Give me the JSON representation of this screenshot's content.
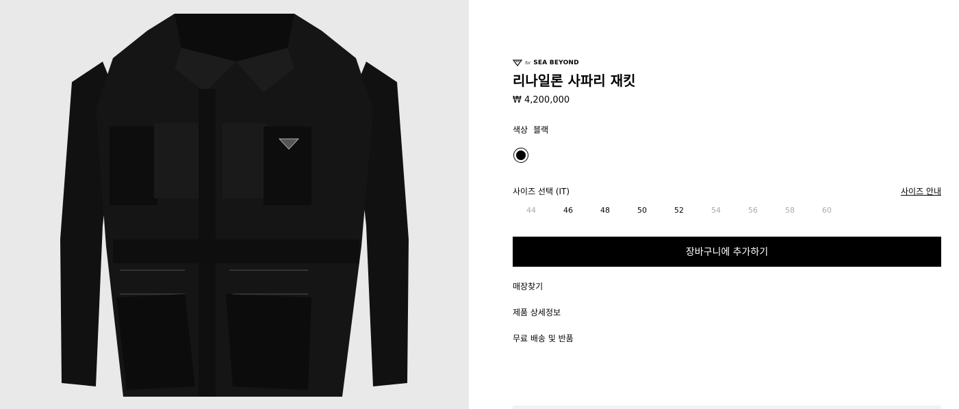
{
  "product": {
    "image_alt": "black nylon safari jacket",
    "badge": {
      "icon": "triangle-logo-icon",
      "for_text": "for",
      "brand_text": "SEA BEYOND"
    },
    "title": "리나일론 사파리 재킷",
    "price": "₩ 4,200,000",
    "color_label": "색상",
    "color_value": "블랙",
    "swatches": [
      {
        "color": "#000000",
        "selected": true
      }
    ],
    "size_label": "사이즈 선택 (IT)",
    "size_guide": "사이즈 안내",
    "sizes": [
      {
        "label": "44",
        "available": false
      },
      {
        "label": "46",
        "available": true
      },
      {
        "label": "48",
        "available": true
      },
      {
        "label": "50",
        "available": true
      },
      {
        "label": "52",
        "available": true
      },
      {
        "label": "54",
        "available": false
      },
      {
        "label": "56",
        "available": false
      },
      {
        "label": "58",
        "available": false
      },
      {
        "label": "60",
        "available": false
      }
    ],
    "add_to_cart": "장바구니에 추가하기",
    "links": [
      "매장찾기",
      "제품 상세정보",
      "무료 배송 및 반품"
    ]
  }
}
